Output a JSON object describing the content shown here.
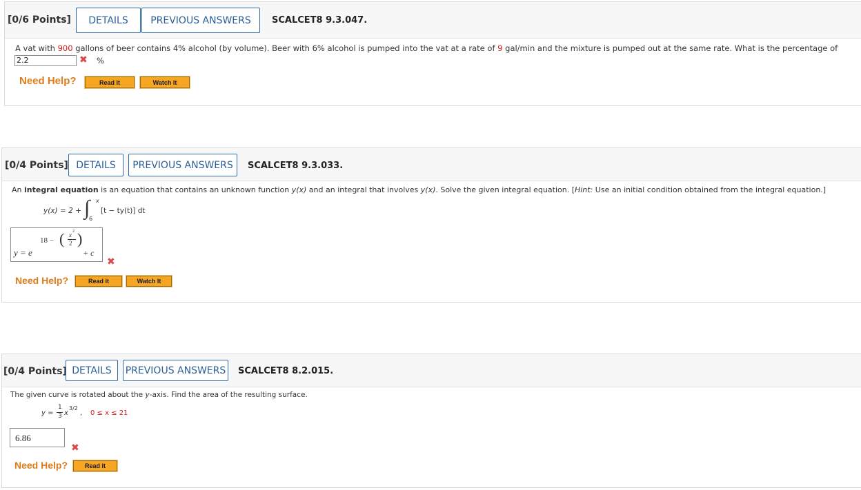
{
  "q1": {
    "points": "[0/6 Points]",
    "details_label": "DETAILS",
    "prev_label": "PREVIOUS ANSWERS",
    "code": "SCALCET8 9.3.047.",
    "text_a": "A vat with ",
    "text_red1": "900",
    "text_b": " gallons of beer contains 4% alcohol (by volume). Beer with 6% alcohol is pumped into the vat at a rate of ",
    "text_red2": "9",
    "text_c": " gal/min and the mixture is pumped out at the same rate. What is the percentage of",
    "answer": "2.2",
    "unit": "%",
    "need_help": "Need Help?",
    "read_it": "Read It",
    "watch_it": "Watch It"
  },
  "q2": {
    "points": "[0/4 Points]",
    "details_label": "DETAILS",
    "prev_label": "PREVIOUS ANSWERS",
    "code": "SCALCET8 9.3.033.",
    "text_a": "An ",
    "text_bold": "integral equation",
    "text_b": " is an equation that contains an unknown function ",
    "fx": "y(x)",
    "text_c": " and an integral that involves ",
    "text_d": ". Solve the given integral equation. [",
    "hint": "Hint:",
    "text_e": " Use an initial condition obtained from the integral equation.]",
    "eq_lhs": "y(x) = 2 +",
    "eq_upper": "x",
    "eq_lower": "6",
    "eq_integrand": "[t − ty(t)] dt",
    "ans_y": "y = e",
    "ans_exp_18": "18 −",
    "ans_x2": "x",
    "ans_sq": "2",
    "ans_den": "2",
    "ans_plus_c": "+ c",
    "need_help": "Need Help?",
    "read_it": "Read It",
    "watch_it": "Watch It"
  },
  "q3": {
    "points": "[0/4 Points]",
    "details_label": "DETAILS",
    "prev_label": "PREVIOUS ANSWERS",
    "code": "SCALCET8 8.2.015.",
    "text_a": "The given curve is rotated about the ",
    "y_axis": "y",
    "text_b": "-axis. Find the area of the resulting surface.",
    "eq_y": "y =",
    "eq_num": "1",
    "eq_den": "3",
    "eq_x": "x",
    "eq_exp": "3/2",
    "eq_comma": ",",
    "eq_range": "0 ≤ x ≤ 21",
    "answer": "6.86",
    "need_help": "Need Help?",
    "read_it": "Read It"
  },
  "colors": {
    "accent_blue": "#2d5f96",
    "error_red": "#d84848",
    "help_orange": "#e07b1a",
    "button_orange": "#f6a623"
  }
}
